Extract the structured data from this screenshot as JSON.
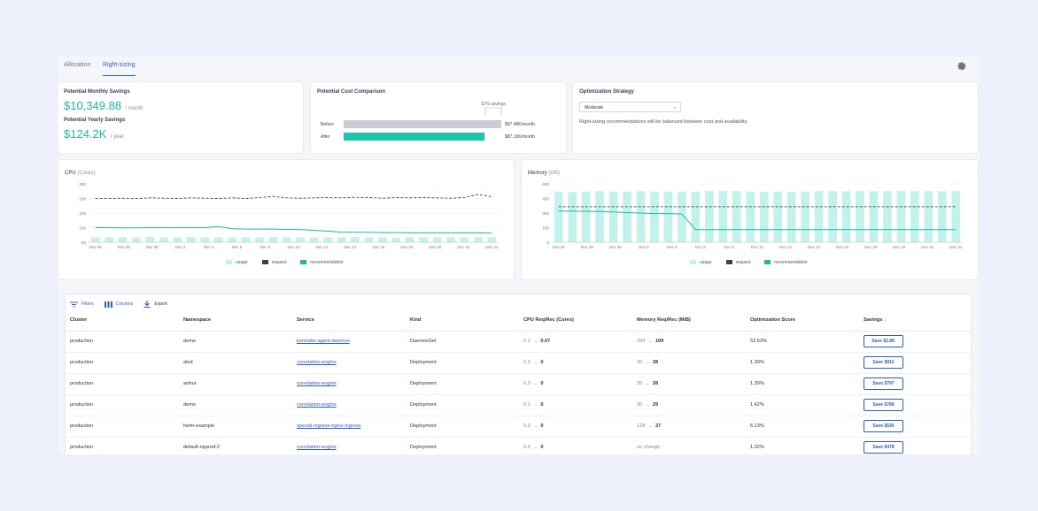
{
  "tabs": [
    {
      "label": "Allocation"
    },
    {
      "label": "Right-sizing"
    }
  ],
  "savings": {
    "monthly_label": "Potential Monthly Savings",
    "monthly_value": "$10,349.88",
    "monthly_unit": "/ month",
    "yearly_label": "Potential Yearly Savings",
    "yearly_value": "$124.2K",
    "yearly_unit": "/ year"
  },
  "comparison": {
    "title": "Potential Cost Comparison",
    "savings_pct": "11% savings",
    "before_label": "Before",
    "before_value": "$97.48K/month",
    "before_amount": 97.48,
    "after_label": "After",
    "after_value": "$87.13K/month",
    "after_amount": 87.13
  },
  "strategy": {
    "title": "Optimization Strategy",
    "selected": "Moderate",
    "description": "Right-sizing recommendations will be balanced between cost and availability."
  },
  "colors": {
    "accent": "#2f5bd3",
    "teal": "#1eb8a6",
    "usage": "#c3f1ec",
    "request": "#3b3f4e",
    "before": "#c9ccd6"
  },
  "chart_data": [
    {
      "type": "bar",
      "title": "CPU",
      "unit": "(Cores)",
      "yticks": [
        50,
        100,
        150,
        200,
        250
      ],
      "ylim": [
        50,
        250
      ],
      "xticks": [
        "Nov 26",
        "Nov 28",
        "Nov 30",
        "Dec 2",
        "Dec 4",
        "Dec 6",
        "Dec 8",
        "Dec 10",
        "Dec 12",
        "Dec 14",
        "Dec 16",
        "Dec 18",
        "Dec 20",
        "Dec 22",
        "Dec 24"
      ],
      "series": [
        {
          "name": "usage",
          "values": [
            67,
            67,
            67,
            66,
            68,
            67,
            67,
            68,
            67,
            67,
            66,
            67,
            67,
            68,
            67,
            67,
            66,
            67,
            67,
            68,
            67,
            67,
            66,
            67,
            67,
            67,
            67,
            66,
            67,
            67
          ]
        },
        {
          "name": "request",
          "values": [
            200,
            200,
            201,
            200,
            202,
            201,
            200,
            202,
            201,
            200,
            202,
            200,
            203,
            207,
            202,
            201,
            202,
            203,
            202,
            204,
            203,
            201,
            203,
            202,
            203,
            202,
            201,
            203,
            214,
            206
          ]
        },
        {
          "name": "recommendation",
          "values": [
            100,
            100,
            99,
            99,
            100,
            100,
            100,
            100,
            100,
            104,
            96,
            95,
            95,
            95,
            94,
            93,
            91,
            88,
            85,
            84,
            84,
            83,
            83,
            82,
            82,
            82,
            82,
            82,
            82,
            81
          ]
        }
      ],
      "legend": [
        "usage",
        "request",
        "recommendation"
      ],
      "legend_position": "bottom"
    },
    {
      "type": "bar",
      "title": "Memory",
      "unit": "(GB)",
      "yticks": [
        0,
        150,
        300,
        450,
        600
      ],
      "ylim": [
        0,
        600
      ],
      "xticks": [
        "Nov 26",
        "Nov 28",
        "Nov 30",
        "Dec 2",
        "Dec 4",
        "Dec 6",
        "Dec 8",
        "Dec 10",
        "Dec 12",
        "Dec 14",
        "Dec 16",
        "Dec 18",
        "Dec 20",
        "Dec 22",
        "Dec 24"
      ],
      "series": [
        {
          "name": "usage",
          "values": [
            520,
            515,
            520,
            525,
            520,
            520,
            525,
            520,
            520,
            520,
            520,
            525,
            525,
            525,
            520,
            520,
            520,
            520,
            520,
            525,
            525,
            525,
            525,
            525,
            525,
            525,
            525,
            525,
            525,
            525
          ]
        },
        {
          "name": "request",
          "values": [
            365,
            365,
            365,
            365,
            365,
            365,
            365,
            365,
            365,
            365,
            365,
            365,
            365,
            365,
            365,
            365,
            365,
            365,
            365,
            365,
            365,
            365,
            365,
            365,
            365,
            365,
            365,
            365,
            365,
            365
          ]
        },
        {
          "name": "recommendation",
          "values": [
            320,
            320,
            318,
            316,
            312,
            305,
            300,
            295,
            295,
            290,
            130,
            130,
            130,
            130,
            130,
            130,
            130,
            130,
            130,
            130,
            130,
            130,
            130,
            130,
            130,
            130,
            130,
            130,
            130,
            130
          ]
        }
      ],
      "legend": [
        "usage",
        "request",
        "recommendation"
      ],
      "legend_position": "bottom"
    }
  ],
  "table": {
    "toolbar": {
      "filters": "Filters",
      "columns": "Columns",
      "export": "Export"
    },
    "columns": [
      "Cluster",
      "Namespace",
      "Service",
      "Kind",
      "CPU Req/Rec (Cores)",
      "Memory Req/Rec (MiB)",
      "Optimization Score",
      "Savings"
    ],
    "rows": [
      {
        "cluster": "production",
        "namespace": "demo",
        "service": "komodor-agent-daemon",
        "kind": "DaemonSet",
        "cpu_req": "0.1",
        "cpu_rec": "0.07",
        "mem_req": "394",
        "mem_rec": "109",
        "score": "52.63%",
        "save": "Save $2.8K"
      },
      {
        "cluster": "production",
        "namespace": "aled",
        "service": "correlation-engine",
        "kind": "Deployment",
        "cpu_req": "0.3",
        "cpu_rec": "0",
        "mem_req": "30",
        "mem_rec": "28",
        "score": "1.39%",
        "save": "Save $812"
      },
      {
        "cluster": "production",
        "namespace": "arthur",
        "service": "correlation-engine",
        "kind": "Deployment",
        "cpu_req": "0.3",
        "cpu_rec": "0",
        "mem_req": "30",
        "mem_rec": "28",
        "score": "1.39%",
        "save": "Save $797"
      },
      {
        "cluster": "production",
        "namespace": "demo",
        "service": "correlation-engine",
        "kind": "Deployment",
        "cpu_req": "0.3",
        "cpu_rec": "0",
        "mem_req": "30",
        "mem_rec": "29",
        "score": "1.42%",
        "save": "Save $789"
      },
      {
        "cluster": "production",
        "namespace": "helm-example",
        "service": "special-ingress-nginx-ingress",
        "kind": "Deployment",
        "cpu_req": "0.3",
        "cpu_rec": "0",
        "mem_req": "128",
        "mem_rec": "27",
        "score": "6.13%",
        "save": "Save $530"
      },
      {
        "cluster": "production",
        "namespace": "default-npprod-2",
        "service": "correlation-engine",
        "kind": "Deployment",
        "cpu_req": "0.3",
        "cpu_rec": "0",
        "mem_req": "no change",
        "mem_rec": "",
        "score": "1.32%",
        "save": "Save $478"
      }
    ]
  }
}
